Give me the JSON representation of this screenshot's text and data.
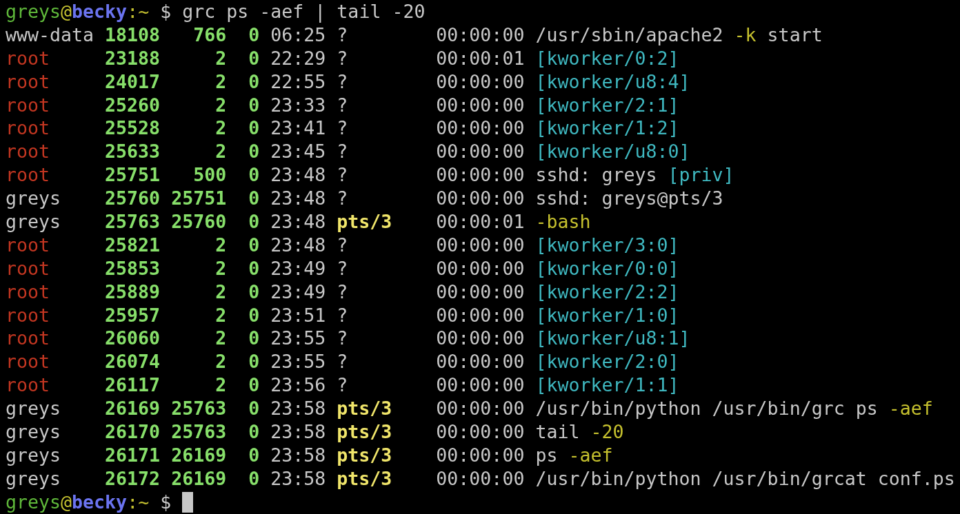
{
  "prompt": {
    "user": "greys",
    "at": "@",
    "host": "becky",
    "path": ":~",
    "symbol": "$",
    "command": "grc ps -aef | tail -20",
    "cursor": false
  },
  "rows": [
    {
      "user": {
        "text": "www-data",
        "color": "#c7c7c7"
      },
      "pid": "18108",
      "ppid": "766",
      "c": "0",
      "stime": "06:25",
      "tty": {
        "text": "?",
        "kind": "none"
      },
      "time": "00:00:00",
      "cmd": [
        {
          "text": "/usr/sbin/apache2",
          "kind": "plain"
        },
        {
          "text": "-k",
          "kind": "option"
        },
        {
          "text": "start",
          "kind": "plain"
        }
      ]
    },
    {
      "user": {
        "text": "root",
        "color": "#c23621"
      },
      "pid": "23188",
      "ppid": "2",
      "c": "0",
      "stime": "22:29",
      "tty": {
        "text": "?",
        "kind": "none"
      },
      "time": "00:00:01",
      "cmd": [
        {
          "text": "[kworker/0:2]",
          "kind": "bracket"
        }
      ]
    },
    {
      "user": {
        "text": "root",
        "color": "#c23621"
      },
      "pid": "24017",
      "ppid": "2",
      "c": "0",
      "stime": "22:55",
      "tty": {
        "text": "?",
        "kind": "none"
      },
      "time": "00:00:00",
      "cmd": [
        {
          "text": "[kworker/u8:4]",
          "kind": "bracket"
        }
      ]
    },
    {
      "user": {
        "text": "root",
        "color": "#c23621"
      },
      "pid": "25260",
      "ppid": "2",
      "c": "0",
      "stime": "23:33",
      "tty": {
        "text": "?",
        "kind": "none"
      },
      "time": "00:00:00",
      "cmd": [
        {
          "text": "[kworker/2:1]",
          "kind": "bracket"
        }
      ]
    },
    {
      "user": {
        "text": "root",
        "color": "#c23621"
      },
      "pid": "25528",
      "ppid": "2",
      "c": "0",
      "stime": "23:41",
      "tty": {
        "text": "?",
        "kind": "none"
      },
      "time": "00:00:00",
      "cmd": [
        {
          "text": "[kworker/1:2]",
          "kind": "bracket"
        }
      ]
    },
    {
      "user": {
        "text": "root",
        "color": "#c23621"
      },
      "pid": "25633",
      "ppid": "2",
      "c": "0",
      "stime": "23:45",
      "tty": {
        "text": "?",
        "kind": "none"
      },
      "time": "00:00:00",
      "cmd": [
        {
          "text": "[kworker/u8:0]",
          "kind": "bracket"
        }
      ]
    },
    {
      "user": {
        "text": "root",
        "color": "#c23621"
      },
      "pid": "25751",
      "ppid": "500",
      "c": "0",
      "stime": "23:48",
      "tty": {
        "text": "?",
        "kind": "none"
      },
      "time": "00:00:00",
      "cmd": [
        {
          "text": "sshd: greys",
          "kind": "plain"
        },
        {
          "text": "[priv]",
          "kind": "bracket"
        }
      ]
    },
    {
      "user": {
        "text": "greys",
        "color": "#c7c7c7"
      },
      "pid": "25760",
      "ppid": "25751",
      "c": "0",
      "stime": "23:48",
      "tty": {
        "text": "?",
        "kind": "none"
      },
      "time": "00:00:00",
      "cmd": [
        {
          "text": "sshd: greys@pts/3",
          "kind": "plain"
        }
      ]
    },
    {
      "user": {
        "text": "greys",
        "color": "#c7c7c7"
      },
      "pid": "25763",
      "ppid": "25760",
      "c": "0",
      "stime": "23:48",
      "tty": {
        "text": "pts/3",
        "kind": "terminal"
      },
      "time": "00:00:01",
      "cmd": [
        {
          "text": "-bash",
          "kind": "option"
        }
      ]
    },
    {
      "user": {
        "text": "root",
        "color": "#c23621"
      },
      "pid": "25821",
      "ppid": "2",
      "c": "0",
      "stime": "23:48",
      "tty": {
        "text": "?",
        "kind": "none"
      },
      "time": "00:00:00",
      "cmd": [
        {
          "text": "[kworker/3:0]",
          "kind": "bracket"
        }
      ]
    },
    {
      "user": {
        "text": "root",
        "color": "#c23621"
      },
      "pid": "25853",
      "ppid": "2",
      "c": "0",
      "stime": "23:49",
      "tty": {
        "text": "?",
        "kind": "none"
      },
      "time": "00:00:00",
      "cmd": [
        {
          "text": "[kworker/0:0]",
          "kind": "bracket"
        }
      ]
    },
    {
      "user": {
        "text": "root",
        "color": "#c23621"
      },
      "pid": "25889",
      "ppid": "2",
      "c": "0",
      "stime": "23:49",
      "tty": {
        "text": "?",
        "kind": "none"
      },
      "time": "00:00:00",
      "cmd": [
        {
          "text": "[kworker/2:2]",
          "kind": "bracket"
        }
      ]
    },
    {
      "user": {
        "text": "root",
        "color": "#c23621"
      },
      "pid": "25957",
      "ppid": "2",
      "c": "0",
      "stime": "23:51",
      "tty": {
        "text": "?",
        "kind": "none"
      },
      "time": "00:00:00",
      "cmd": [
        {
          "text": "[kworker/1:0]",
          "kind": "bracket"
        }
      ]
    },
    {
      "user": {
        "text": "root",
        "color": "#c23621"
      },
      "pid": "26060",
      "ppid": "2",
      "c": "0",
      "stime": "23:55",
      "tty": {
        "text": "?",
        "kind": "none"
      },
      "time": "00:00:00",
      "cmd": [
        {
          "text": "[kworker/u8:1]",
          "kind": "bracket"
        }
      ]
    },
    {
      "user": {
        "text": "root",
        "color": "#c23621"
      },
      "pid": "26074",
      "ppid": "2",
      "c": "0",
      "stime": "23:55",
      "tty": {
        "text": "?",
        "kind": "none"
      },
      "time": "00:00:00",
      "cmd": [
        {
          "text": "[kworker/2:0]",
          "kind": "bracket"
        }
      ]
    },
    {
      "user": {
        "text": "root",
        "color": "#c23621"
      },
      "pid": "26117",
      "ppid": "2",
      "c": "0",
      "stime": "23:56",
      "tty": {
        "text": "?",
        "kind": "none"
      },
      "time": "00:00:00",
      "cmd": [
        {
          "text": "[kworker/1:1]",
          "kind": "bracket"
        }
      ]
    },
    {
      "user": {
        "text": "greys",
        "color": "#c7c7c7"
      },
      "pid": "26169",
      "ppid": "25763",
      "c": "0",
      "stime": "23:58",
      "tty": {
        "text": "pts/3",
        "kind": "terminal"
      },
      "time": "00:00:00",
      "cmd": [
        {
          "text": "/usr/bin/python /usr/bin/grc ps",
          "kind": "plain"
        },
        {
          "text": "-aef",
          "kind": "option"
        }
      ]
    },
    {
      "user": {
        "text": "greys",
        "color": "#c7c7c7"
      },
      "pid": "26170",
      "ppid": "25763",
      "c": "0",
      "stime": "23:58",
      "tty": {
        "text": "pts/3",
        "kind": "terminal"
      },
      "time": "00:00:00",
      "cmd": [
        {
          "text": "tail",
          "kind": "plain"
        },
        {
          "text": "-20",
          "kind": "option"
        }
      ]
    },
    {
      "user": {
        "text": "greys",
        "color": "#c7c7c7"
      },
      "pid": "26171",
      "ppid": "26169",
      "c": "0",
      "stime": "23:58",
      "tty": {
        "text": "pts/3",
        "kind": "terminal"
      },
      "time": "00:00:00",
      "cmd": [
        {
          "text": "ps",
          "kind": "plain"
        },
        {
          "text": "-aef",
          "kind": "option"
        }
      ]
    },
    {
      "user": {
        "text": "greys",
        "color": "#c7c7c7"
      },
      "pid": "26172",
      "ppid": "26169",
      "c": "0",
      "stime": "23:58",
      "tty": {
        "text": "pts/3",
        "kind": "terminal"
      },
      "time": "00:00:00",
      "cmd": [
        {
          "text": "/usr/bin/python /usr/bin/grcat conf.ps",
          "kind": "plain"
        }
      ]
    }
  ],
  "prompt_end": {
    "user": "greys",
    "at": "@",
    "host": "becky",
    "path": ":~",
    "symbol": "$",
    "cursor": true
  }
}
